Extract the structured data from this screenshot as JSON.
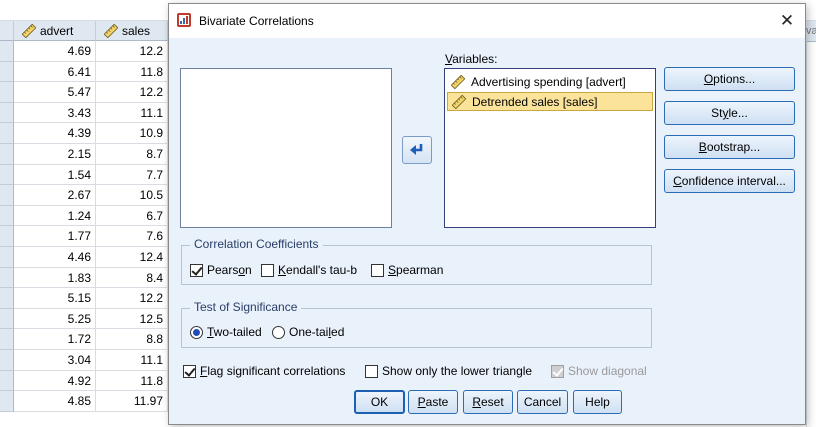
{
  "spreadsheet": {
    "columns": [
      "advert",
      "sales"
    ],
    "right_header_fragment": "va",
    "rows": [
      [
        "4.69",
        "12.2"
      ],
      [
        "6.41",
        "11.8"
      ],
      [
        "5.47",
        "12.2"
      ],
      [
        "3.43",
        "11.1"
      ],
      [
        "4.39",
        "10.9"
      ],
      [
        "2.15",
        "8.7"
      ],
      [
        "1.54",
        "7.7"
      ],
      [
        "2.67",
        "10.5"
      ],
      [
        "1.24",
        "6.7"
      ],
      [
        "1.77",
        "7.6"
      ],
      [
        "4.46",
        "12.4"
      ],
      [
        "1.83",
        "8.4"
      ],
      [
        "5.15",
        "12.2"
      ],
      [
        "5.25",
        "12.5"
      ],
      [
        "1.72",
        "8.8"
      ],
      [
        "3.04",
        "11.1"
      ],
      [
        "4.92",
        "11.8"
      ],
      [
        "4.85",
        "11.97"
      ]
    ]
  },
  "dialog": {
    "title": "Bivariate Correlations",
    "close_glyph": "✕",
    "variables_label": "Variables:",
    "variables": [
      {
        "label": "Advertising spending [advert]",
        "selected": false
      },
      {
        "label": "Detrended sales [sales]",
        "selected": true
      }
    ],
    "side_buttons": {
      "options": "Options...",
      "style": "Style...",
      "bootstrap": "Bootstrap...",
      "confidence": "Confidence interval..."
    },
    "coefficients": {
      "legend": "Correlation Coefficients",
      "pearson": "Pearson",
      "kendall": "Kendall's tau-b",
      "spearman": "Spearman"
    },
    "significance": {
      "legend": "Test of Significance",
      "two_tailed": "Two-tailed",
      "one_tailed": "One-tailed"
    },
    "flags": {
      "flag_significant": "Flag significant correlations",
      "lower_triangle": "Show only the lower triangle",
      "show_diagonal": "Show diagonal"
    },
    "buttons": {
      "ok": "OK",
      "paste": "Paste",
      "reset": "Reset",
      "cancel": "Cancel",
      "help": "Help"
    }
  }
}
